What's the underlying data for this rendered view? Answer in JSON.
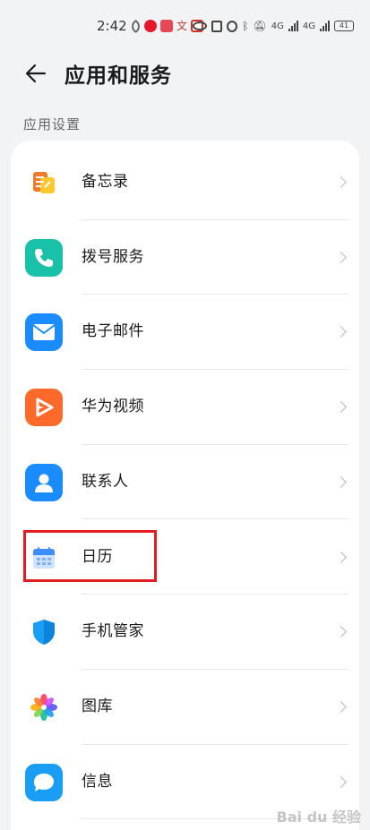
{
  "status_bar": {
    "time": "2:42",
    "network_label_1": "4G",
    "network_label_2": "4G",
    "battery": "41"
  },
  "header": {
    "title": "应用和服务"
  },
  "section": {
    "label": "应用设置"
  },
  "items": [
    {
      "label": "备忘录",
      "icon": "memo-icon",
      "color": "#f59a23"
    },
    {
      "label": "拨号服务",
      "icon": "phone-icon",
      "color": "#19c1a8"
    },
    {
      "label": "电子邮件",
      "icon": "email-icon",
      "color": "#1a8cff"
    },
    {
      "label": "华为视频",
      "icon": "video-icon",
      "color": "#ff6a2b"
    },
    {
      "label": "联系人",
      "icon": "contacts-icon",
      "color": "#1a8cff"
    },
    {
      "label": "日历",
      "icon": "calendar-icon",
      "color": "#3d8ef8"
    },
    {
      "label": "手机管家",
      "icon": "shield-icon",
      "color": "#1a9df5"
    },
    {
      "label": "图库",
      "icon": "gallery-icon",
      "color": "#ff4d6a"
    },
    {
      "label": "信息",
      "icon": "message-icon",
      "color": "#1a9df5"
    }
  ],
  "watermark": "Bai du 经验"
}
